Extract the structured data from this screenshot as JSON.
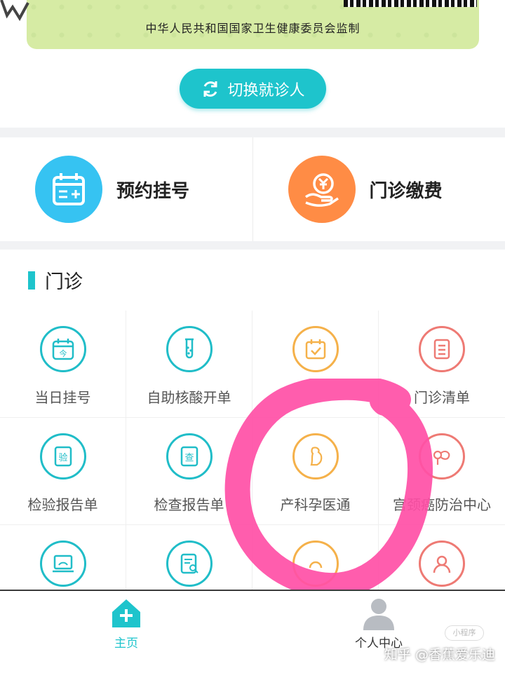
{
  "code_card": {
    "monitor_text": "中华人民共和国国家卫生健康委员会监制"
  },
  "switch_patient": {
    "label": "切换就诊人"
  },
  "main_services": [
    {
      "label": "预约挂号",
      "icon": "calendar-plus-icon",
      "color": "#36c3f2"
    },
    {
      "label": "门诊缴费",
      "icon": "payment-hand-icon",
      "color": "#ff8c45"
    }
  ],
  "section": {
    "title": "门诊"
  },
  "grid_items": [
    {
      "label": "当日挂号",
      "icon": "calendar-today-icon",
      "glyph": "今"
    },
    {
      "label": "自助核酸开单",
      "icon": "test-tube-icon"
    },
    {
      "label": "",
      "icon": "calendar-check-icon"
    },
    {
      "label": "门诊清单",
      "icon": "list-icon"
    },
    {
      "label": "检验报告单",
      "icon": "lab-report-icon",
      "glyph": "验"
    },
    {
      "label": "检查报告单",
      "icon": "exam-report-icon",
      "glyph": "查"
    },
    {
      "label": "产科孕医通",
      "icon": "pregnancy-icon"
    },
    {
      "label": "宫颈癌防治中心",
      "icon": "cervical-center-icon"
    },
    {
      "label": "",
      "icon": "ultrasound-icon"
    },
    {
      "label": "",
      "icon": "document-search-icon"
    },
    {
      "label": "",
      "icon": "orange-partial-icon"
    },
    {
      "label": "",
      "icon": "user-icon"
    }
  ],
  "bottom_nav": {
    "home": "主页",
    "profile": "个人中心"
  },
  "watermark": {
    "text": "知乎 @香蕉爱乐迪",
    "badge": "小程序"
  },
  "colors": {
    "accent": "#1ec4cc",
    "annotation": "#ff4fa6"
  }
}
